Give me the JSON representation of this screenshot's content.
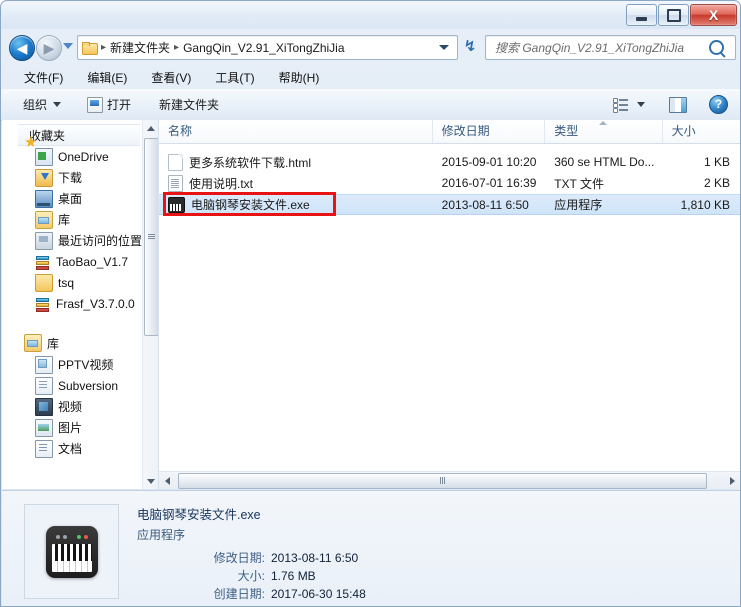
{
  "window": {
    "minimize_label": "Minimize",
    "maximize_label": "Maximize",
    "close_label": "X"
  },
  "nav": {
    "back_label": "◀",
    "forward_label": "▶",
    "history_label": "History",
    "refresh_label": "↯",
    "breadcrumb": [
      "新建文件夹",
      "GangQin_V2.91_XiTongZhiJia"
    ],
    "separator": "▸",
    "search_placeholder": "搜索 GangQin_V2.91_XiTongZhiJia"
  },
  "menubar": {
    "items": [
      "文件(F)",
      "编辑(E)",
      "查看(V)",
      "工具(T)",
      "帮助(H)"
    ]
  },
  "toolbar": {
    "organize_label": "组织",
    "open_label": "打开",
    "new_folder_label": "新建文件夹",
    "help_label": "?"
  },
  "sidebar": {
    "favorites": {
      "header": "收藏夹",
      "items": [
        {
          "label": "OneDrive",
          "icon": "onedrive-icon"
        },
        {
          "label": "下载",
          "icon": "download-icon"
        },
        {
          "label": "桌面",
          "icon": "desktop-icon"
        },
        {
          "label": "库",
          "icon": "library-icon"
        },
        {
          "label": "最近访问的位置",
          "icon": "recent-places-icon"
        },
        {
          "label": "TaoBao_V1.7",
          "icon": "books-icon"
        },
        {
          "label": "tsq",
          "icon": "folder-icon"
        },
        {
          "label": "Frasf_V3.7.0.0",
          "icon": "books-icon"
        }
      ]
    },
    "libraries": {
      "header": "库",
      "items": [
        {
          "label": "PPTV视频",
          "icon": "pptv-icon"
        },
        {
          "label": "Subversion",
          "icon": "subversion-icon"
        },
        {
          "label": "视频",
          "icon": "video-icon"
        },
        {
          "label": "图片",
          "icon": "picture-icon"
        },
        {
          "label": "文档",
          "icon": "document-icon"
        }
      ]
    }
  },
  "filelist": {
    "columns": [
      "名称",
      "修改日期",
      "类型",
      "大小"
    ],
    "sort_column": "类型",
    "rows": [
      {
        "name": "更多系统软件下载.html",
        "date": "2015-09-01 10:20",
        "type": "360 se HTML Do...",
        "size": "1 KB",
        "icon": "html-file-icon",
        "selected": false
      },
      {
        "name": "使用说明.txt",
        "date": "2016-07-01 16:39",
        "type": "TXT 文件",
        "size": "2 KB",
        "icon": "text-file-icon",
        "selected": false
      },
      {
        "name": "电脑钢琴安装文件.exe",
        "date": "2013-08-11 6:50",
        "type": "应用程序",
        "size": "1,810 KB",
        "icon": "exe-file-icon",
        "selected": true
      }
    ]
  },
  "details": {
    "filename": "电脑钢琴安装文件.exe",
    "filetype": "应用程序",
    "fields": [
      {
        "key": "修改日期:",
        "value": "2013-08-11 6:50"
      },
      {
        "key": "大小:",
        "value": "1.76 MB"
      },
      {
        "key": "创建日期:",
        "value": "2017-06-30 15:48"
      }
    ],
    "thumbnail_icon": "piano-icon"
  },
  "colors": {
    "accent": "#2f7fc4",
    "highlight_box": "#e81313",
    "selection": "#cfe4f9",
    "header_text": "#36597d"
  }
}
